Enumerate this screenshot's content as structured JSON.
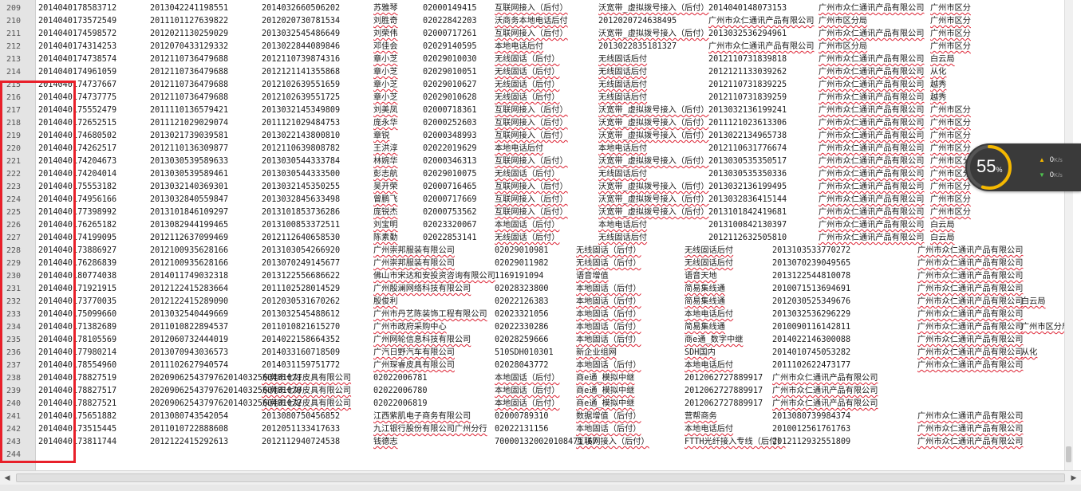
{
  "editor": {
    "lines": [
      {
        "n": "209",
        "cells": [
          "2014040178583712",
          "2013042241198551",
          "2014032660506202",
          "苏雅琴",
          "02000149415",
          "互联网接入（后付）",
          "沃宽带_虚拟拨号接入（后付）",
          "2014040148073153",
          "广州市众仁通讯产品有限公司",
          "广州市区分"
        ]
      },
      {
        "n": "210",
        "cells": [
          "2014040173572549",
          "2011101127639822",
          "2012020730781534",
          "刘胜奇",
          "02022842203",
          "沃商务本地电话后付",
          "2012020724638495",
          "广州市众仁通讯产品有限公司",
          "广州市区分局",
          "广州市区分"
        ]
      },
      {
        "n": "211",
        "cells": [
          "2014040174598572",
          "2012021130259029",
          "2013032545486649",
          "刘荣伟",
          "02000717261",
          "互联网接入（后付）",
          "沃宽带_虚拟拨号接入（后付）",
          "2013032536294961",
          "广州市众仁通讯产品有限公司",
          "广州市区分"
        ]
      },
      {
        "n": "212",
        "cells": [
          "2014040174314253",
          "2012070433129332",
          "2013022844089846",
          "邓佳会",
          "02029140595",
          "本地电话后付",
          "2013022835181327",
          "广州市众仁通讯产品有限公司",
          "广州市区分局",
          "广州市区分"
        ]
      },
      {
        "n": "213",
        "cells": [
          "2014040174738574",
          "2012110736479688",
          "2012110739874316",
          "章小芝",
          "02029010030",
          "无线固话（后付）",
          "无线固话后付",
          "2012110731839818",
          "广州市众仁通讯产品有限公司",
          "白云局"
        ]
      },
      {
        "n": "214",
        "cells": [
          "2014040174961059",
          "2012110736479688",
          "2012121141355868",
          "章小芝",
          "02029010051",
          "无线固话（后付）",
          "无线固话后付",
          "2012121133039262",
          "广州市众仁通讯产品有限公司",
          "从化"
        ]
      },
      {
        "n": "215",
        "cells": [
          "2014040174737667",
          "2012110736479688",
          "2012102639551659",
          "章小芝",
          "02029010627",
          "无线固话（后付）",
          "无线固话后付",
          "2012110731839225",
          "广州市众仁通讯产品有限公司",
          "越秀"
        ]
      },
      {
        "n": "216",
        "cells": [
          "2014040174737775",
          "2012110736479688",
          "2012102639551725",
          "章小芝",
          "02029010628",
          "无线固话（后付）",
          "无线固话后付",
          "2012110731839259",
          "广州市众仁通讯产品有限公司",
          "越秀"
        ]
      },
      {
        "n": "217",
        "cells": [
          "2014040175552479",
          "2011110136579421",
          "2013032145349809",
          "刘美凤",
          "02000718361",
          "互联网接入（后付）",
          "沃宽带_虚拟拨号接入（后付）",
          "2013032136199241",
          "广州市众仁通讯产品有限公司",
          "广州市区分"
        ]
      },
      {
        "n": "218",
        "cells": [
          "2014040172652515",
          "2011121029029074",
          "2011121029484753",
          "庞永华",
          "02000252603",
          "互联网接入（后付）",
          "沃宽带_虚拟拨号接入（后付）",
          "2011121023613306",
          "广州市众仁通讯产品有限公司",
          "广州市区分"
        ]
      },
      {
        "n": "219",
        "cells": [
          "2014040174680502",
          "2013021739039581",
          "2013022143800810",
          "章锐",
          "02000348993",
          "互联网接入（后付）",
          "沃宽带_虚拟拨号接入（后付）",
          "2013022134965738",
          "广州市众仁通讯产品有限公司",
          "广州市区分"
        ]
      },
      {
        "n": "220",
        "cells": [
          "2014040174262517",
          "2012110136309877",
          "2012110639808782",
          "王洪淳",
          "02022019629",
          "本地电话后付",
          "本地电话后付",
          "2012110631776674",
          "广州市众仁通讯产品有限公司",
          "广州市区分"
        ]
      },
      {
        "n": "221",
        "cells": [
          "2014040174204673",
          "2013030539589633",
          "2013030544333784",
          "林婉华",
          "02000346313",
          "互联网接入（后付）",
          "沃宽带_虚拟拨号接入（后付）",
          "2013030535350517",
          "广州市众仁通讯产品有限公司",
          "广州市区分"
        ]
      },
      {
        "n": "222",
        "cells": [
          "2014040174204014",
          "2013030539589461",
          "2013030544333500",
          "彭志航",
          "02029010075",
          "无线固话（后付）",
          "无线固话后付",
          "2013030535350336",
          "广州市众仁通讯产品有限公司",
          "广州市区分"
        ]
      },
      {
        "n": "223",
        "cells": [
          "2014040175553182",
          "2013032140369301",
          "2013032145350255",
          "吴开荣",
          "02000716465",
          "互联网接入（后付）",
          "沃宽带_虚拟拨号接入（后付）",
          "2013032136199495",
          "广州市众仁通讯产品有限公司",
          "广州市区分"
        ]
      },
      {
        "n": "224",
        "cells": [
          "2014040174956166",
          "2013032840559847",
          "2013032845633498",
          "曾鹏飞",
          "02000717669",
          "互联网接入（后付）",
          "沃宽带_虚拟拨号接入（后付）",
          "2013032836415144",
          "广州市众仁通讯产品有限公司",
          "广州市区分"
        ]
      },
      {
        "n": "225",
        "cells": [
          "2014040177398992",
          "2013101846109297",
          "2013101853736286",
          "庞锐杰",
          "02000753562",
          "互联网接入（后付）",
          "沃宽带_虚拟拨号接入（后付）",
          "2013101842419681",
          "广州市众仁通讯产品有限公司",
          "广州市区分"
        ]
      },
      {
        "n": "226",
        "cells": [
          "2014040176265182",
          "2013082944199465",
          "2013100853372511",
          "刘宝明",
          "02023320067",
          "本地固话（后付）",
          "本地电话后付",
          "2013100842130397",
          "广州市众仁通讯产品有限公司",
          "白云局"
        ]
      },
      {
        "n": "227",
        "cells": [
          "2014040174199095",
          "2012112637099469",
          "2012112640658530",
          "陈素勤",
          "02022853141",
          "无线固话（后付）",
          "无线固话后付",
          "2012112632505810",
          "广州市众仁通讯产品有限公司",
          "白云局"
        ]
      },
      {
        "n": "228",
        "cells": [
          "2014040173886927",
          "2012100935628166",
          "2013103054266920",
          "广州崇邦服装有限公司",
          "02029010981",
          "无线固话（后付）",
          "无线固话后付",
          "2013103533770272",
          "广州市众仁通讯产品有限公司"
        ]
      },
      {
        "n": "229",
        "cells": [
          "2014040176286839",
          "2012100935628166",
          "2013070249145677",
          "广州崇邦服装有限公司",
          "02029011982",
          "无线固话（后付）",
          "无线固话后付",
          "2013070239049565",
          "广州市众仁通讯产品有限公司"
        ]
      },
      {
        "n": "230",
        "cells": [
          "2014040180774038",
          "2014011749032318",
          "2013122556686622",
          "佛山市宋达和安投资咨询有限公司",
          "1169191094",
          "语音增值",
          "语音天地",
          "2013122544810078",
          "广州市众仁通讯产品有限公司"
        ]
      },
      {
        "n": "231",
        "cells": [
          "2014040171921915",
          "2012122415283664",
          "2011102528014529",
          "广州殷澜网络科技有限公司",
          "02028323800",
          "本地固话（后付）",
          "简易集线通",
          "2010071513694691",
          "广州市众仁通讯产品有限公司"
        ]
      },
      {
        "n": "232",
        "cells": [
          "2014040173770035",
          "2012122415289090",
          "2012030531670262",
          "殷俊利",
          "02022126383",
          "本地固话（后付）",
          "简易集线通",
          "2012030525349676",
          "广州市众仁通讯产品有限公司",
          "白云局"
        ]
      },
      {
        "n": "233",
        "cells": [
          "2014040175099660",
          "2013032540449669",
          "2013032545488612",
          "广州市丹艺陈装饰工程有限公司",
          "02023321056",
          "本地固话（后付）",
          "本地电话后付",
          "2013032536296229",
          "广州市众仁通讯产品有限公司"
        ]
      },
      {
        "n": "234",
        "cells": [
          "2014040171382689",
          "2011010822894537",
          "2011010821615270",
          "广州市政府采购中心",
          "02022330286",
          "本地固话（后付）",
          "简易集线通",
          "2010090116142811",
          "广州市众仁通讯产品有限公司",
          "广州市区分局"
        ]
      },
      {
        "n": "235",
        "cells": [
          "2014040178105569",
          "2012060732444019",
          "2014022158664352",
          "广州网轮信息科技有限公司",
          "02028259666",
          "本地固话（后付）",
          "商e通_数字中继",
          "2014022146300088",
          "广州市众仁通讯产品有限公司"
        ]
      },
      {
        "n": "236",
        "cells": [
          "2014040177980214",
          "2013070943036573",
          "2014033160718509",
          "广汽日野汽车有限公司",
          "510SDH010301",
          "新企业组网",
          "SDH国内",
          "2014010745053282",
          "广州市众仁通讯产品有限公司",
          "从化"
        ]
      },
      {
        "n": "237",
        "cells": [
          "2014040178554960",
          "2011102627940574",
          "2014031159751772",
          "广州琛睿皮具有限公司",
          "02028043772",
          "本地固话（后付）",
          "本地电话后付",
          "2011102622473177",
          "广州市众仁通讯产品有限公司"
        ]
      },
      {
        "n": "238",
        "cells": [
          "2014040178827519",
          "2020906254379762014032560481071",
          "东莞市七好皮具有限公司",
          "02022006781",
          "本地固话（后付）",
          "商e通_模拟中继",
          "2012062727889917",
          "广州市众仁通讯产品有限公司"
        ]
      },
      {
        "n": "239",
        "cells": [
          "2014040178827517",
          "2020906254379762014032560481070",
          "东莞市七好皮具有限公司",
          "02022006780",
          "本地固话（后付）",
          "商e通_模拟中继",
          "2012062727889917",
          "广州市众仁通讯产品有限公司"
        ]
      },
      {
        "n": "240",
        "cells": [
          "2014040178827521",
          "2020906254379762014032560481072",
          "东莞市七好皮具有限公司",
          "02022006819",
          "本地固话（后付）",
          "商e通_模拟中继",
          "2012062727889917",
          "广州市众仁通讯产品有限公司"
        ]
      },
      {
        "n": "241",
        "cells": [
          "2014040175651882",
          "2013080743542054",
          "2013080750456852",
          "江西紫肌电子商务有限公司",
          "02000789310",
          "数据增值（后付）",
          "营帮商务",
          "2013080739984374",
          "广州市众仁通讯产品有限公司"
        ]
      },
      {
        "n": "242",
        "cells": [
          "2014040173515445",
          "2011010722888608",
          "2012051133417633",
          "九江银行股份有限公司广州分行",
          "02022131156",
          "本地固话（后付）",
          "本地电话后付",
          "2010012561761763",
          "广州市众仁通讯产品有限公司"
        ]
      },
      {
        "n": "243",
        "cells": [
          "2014040173811744",
          "2012122415292613",
          "2012112940724538",
          "钱德志",
          "700001320020108471 67",
          "互联网接入（后付）",
          "FTTH光纤接入专线（后付）",
          "2012112932551809",
          "广州市众仁通讯产品有限公司"
        ]
      },
      {
        "n": "244",
        "cells": []
      }
    ]
  },
  "netmonitor": {
    "cpu_percent": "55",
    "percent_sign": "%",
    "upload_speed": "0",
    "download_speed": "0",
    "speed_unit": "K/s",
    "upload_icon": "up-arrow-icon",
    "download_icon": "down-arrow-icon",
    "gauge_fraction": 0.55,
    "gauge_color": "#f5b800",
    "widget_bg": "#3a3a3a"
  },
  "highlight": {
    "color": "#e8202a"
  }
}
